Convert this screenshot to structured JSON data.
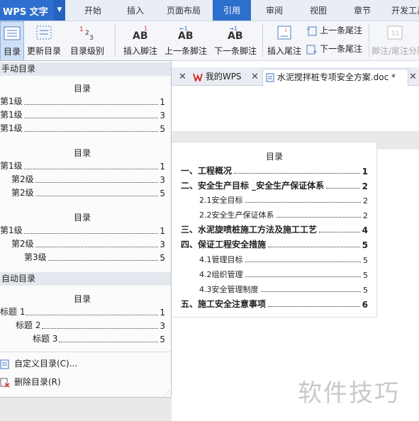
{
  "menubar": {
    "app_label": "WPS 文字",
    "tabs": [
      "开始",
      "插入",
      "页面布局",
      "引用",
      "审阅",
      "视图",
      "章节",
      "开发工具"
    ]
  },
  "ribbon": {
    "toc_label": "目录",
    "update_toc": "更新目录",
    "toc_level": "目录级别",
    "insert_footnote": "插入脚注",
    "prev_footnote": "上一条脚注",
    "next_footnote": "下一条脚注",
    "insert_endnote": "插入尾注",
    "prev_endnote": "上一条尾注",
    "next_endnote": "下一条尾注",
    "footnote_sep": "脚注/尾注分隔"
  },
  "doc_tabs": {
    "my_wps": "我的WPS",
    "document": "水泥搅拌桩专项安全方案.doc *"
  },
  "document_toc": {
    "title": "目录",
    "entries": [
      {
        "text": "一、工程概况",
        "page": "1",
        "level": 1
      },
      {
        "text": "二、安全生产目标 _安全生产保证体系",
        "page": "2",
        "level": 1
      },
      {
        "text": "2.1安全目标",
        "page": "2",
        "level": 2
      },
      {
        "text": "2.2安全生产保证体系",
        "page": "2",
        "level": 2
      },
      {
        "text": "三、水泥旋喷桩施工方法及施工工艺",
        "page": "4",
        "level": 1
      },
      {
        "text": "四、保证工程安全措施",
        "page": "5",
        "level": 1
      },
      {
        "text": "4.1管理目标",
        "page": "5",
        "level": 2
      },
      {
        "text": "4.2组织管理",
        "page": "5",
        "level": 2
      },
      {
        "text": "4.3安全管理制度",
        "page": "5",
        "level": 2
      },
      {
        "text": "五、施工安全注意事项",
        "page": "6",
        "level": 1
      }
    ]
  },
  "panel": {
    "manual_header": "手动目录",
    "auto_header": "自动目录",
    "samples": [
      {
        "title": "目录",
        "rows": [
          {
            "text": "第1级",
            "page": "1",
            "indent": 0
          },
          {
            "text": "第1级",
            "page": "3",
            "indent": 0
          },
          {
            "text": "第1级",
            "page": "5",
            "indent": 0
          }
        ]
      },
      {
        "title": "目录",
        "rows": [
          {
            "text": "第1级",
            "page": "1",
            "indent": 0
          },
          {
            "text": "第2级",
            "page": "3",
            "indent": 1
          },
          {
            "text": "第2级",
            "page": "5",
            "indent": 1
          }
        ]
      },
      {
        "title": "目录",
        "rows": [
          {
            "text": "第1级",
            "page": "1",
            "indent": 0
          },
          {
            "text": "第2级",
            "page": "3",
            "indent": 1
          },
          {
            "text": "第3级",
            "page": "5",
            "indent": 2
          }
        ]
      },
      {
        "title": "目录",
        "rows": [
          {
            "text": "标题 1",
            "page": "1",
            "indent": 0
          },
          {
            "text": "标题 2",
            "page": "3",
            "indent": 1
          },
          {
            "text": "标题 3",
            "page": "5",
            "indent": 2
          }
        ]
      }
    ],
    "custom_toc": "自定义目录(C)...",
    "delete_toc": "删除目录(R)"
  },
  "watermark": "软件技巧",
  "colors": {
    "accent": "#2e6fcd",
    "wps_red": "#d9302c"
  }
}
